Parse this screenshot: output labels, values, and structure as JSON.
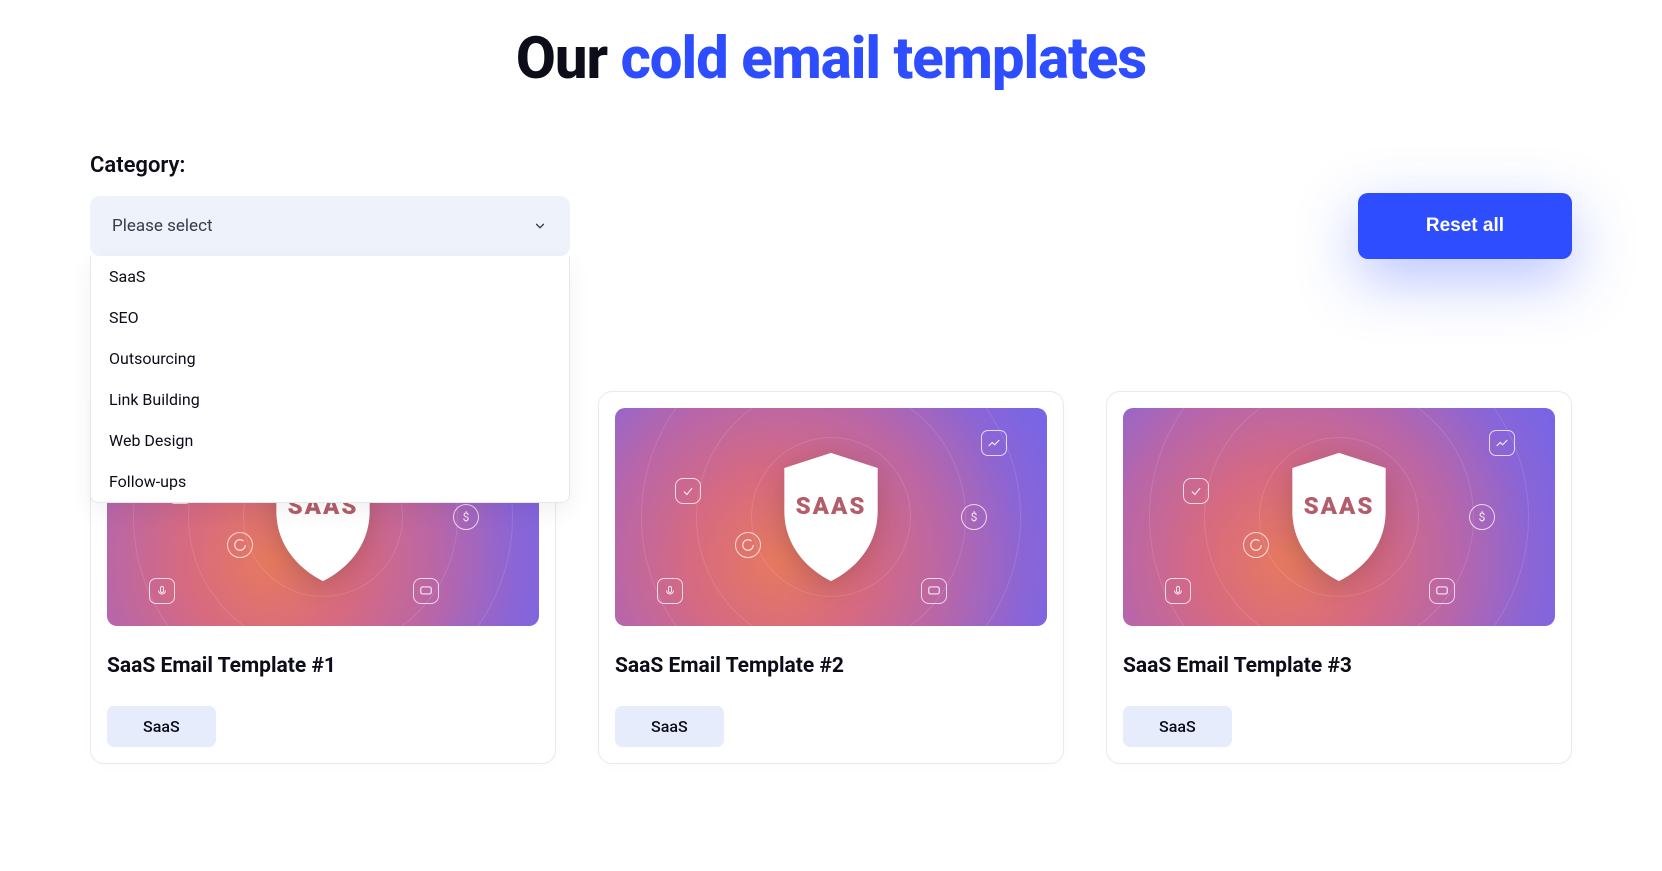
{
  "heading": {
    "part1": "Our ",
    "part2": "cold email templates"
  },
  "filter": {
    "label": "Category:",
    "placeholder": "Please select",
    "options": [
      "SaaS",
      "SEO",
      "Outsourcing",
      "Link Building",
      "Web Design",
      "Follow-ups"
    ]
  },
  "reset_label": "Reset all",
  "shield_text": "SAAS",
  "cards": [
    {
      "title": "SaaS Email Template #1",
      "tag": "SaaS"
    },
    {
      "title": "SaaS Email Template #2",
      "tag": "SaaS"
    },
    {
      "title": "SaaS Email Template #3",
      "tag": "SaaS"
    }
  ]
}
